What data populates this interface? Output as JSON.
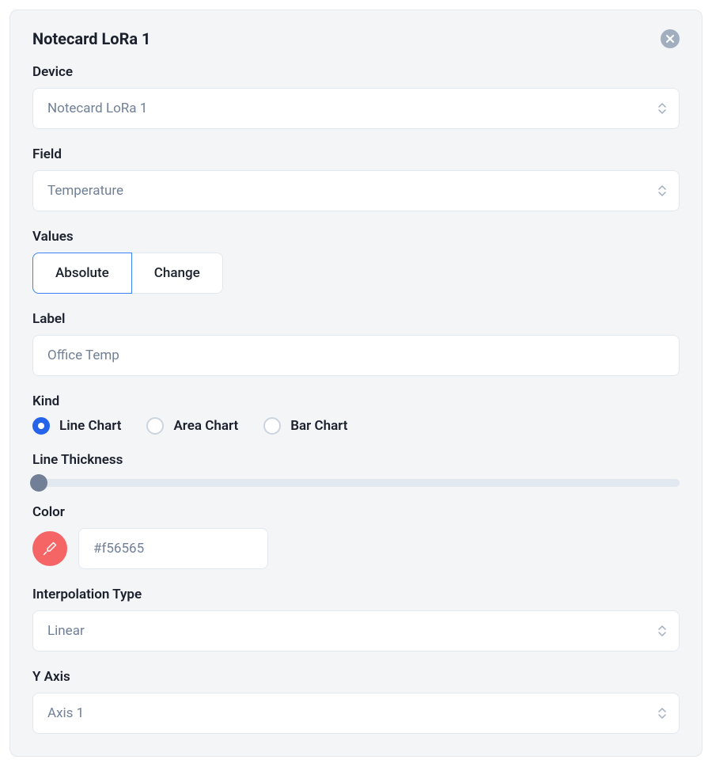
{
  "panel": {
    "title": "Notecard LoRa 1"
  },
  "device": {
    "label": "Device",
    "value": "Notecard LoRa 1"
  },
  "field": {
    "label": "Field",
    "value": "Temperature"
  },
  "values": {
    "label": "Values",
    "options": [
      "Absolute",
      "Change"
    ],
    "selected": "Absolute"
  },
  "chartLabel": {
    "label": "Label",
    "value": "Office Temp"
  },
  "kind": {
    "label": "Kind",
    "options": [
      "Line Chart",
      "Area Chart",
      "Bar Chart"
    ],
    "selected": "Line Chart"
  },
  "lineThickness": {
    "label": "Line Thickness"
  },
  "color": {
    "label": "Color",
    "value": "#f56565"
  },
  "interpolation": {
    "label": "Interpolation Type",
    "value": "Linear"
  },
  "yAxis": {
    "label": "Y Axis",
    "value": "Axis 1"
  }
}
